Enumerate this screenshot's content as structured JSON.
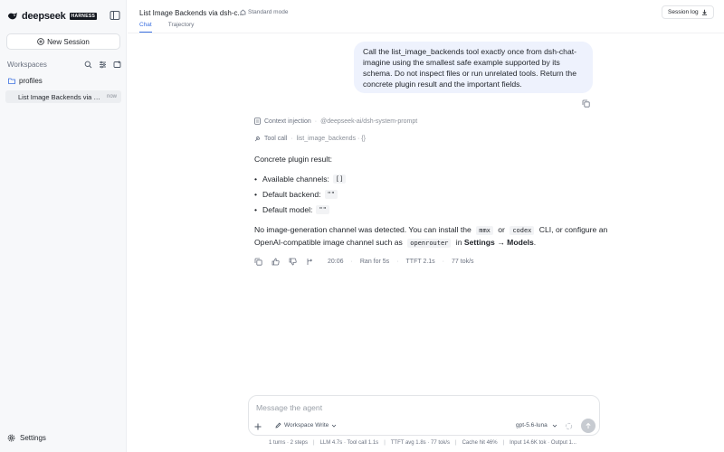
{
  "sidebar": {
    "brand": {
      "name": "deepseek",
      "badge": "HARNESS"
    },
    "new_session_label": "New Session",
    "workspaces_title": "Workspaces",
    "folder": "profiles",
    "session": {
      "name": "List Image Backends via dsh-chat",
      "time": "now"
    },
    "settings_label": "Settings"
  },
  "header": {
    "title": "List Image Backends via dsh-c...",
    "mode": "Standard mode",
    "session_log": "Session log",
    "tabs": [
      {
        "label": "Chat"
      },
      {
        "label": "Trajectory"
      }
    ]
  },
  "conversation": {
    "user_message": "Call the list_image_backends tool exactly once from dsh-chat-imagine using the smallest safe example supported by its schema. Do not inspect files or run unrelated tools. Return the concrete plugin result and the important fields.",
    "context": {
      "label": "Context injection",
      "sep": "·",
      "source": "@deepseek-ai/dsh-system-prompt"
    },
    "tool": {
      "label": "Tool call",
      "sep": "·",
      "name": "list_image_backends · {}"
    },
    "heading": "Concrete plugin result:",
    "bullets": [
      {
        "label": "Available channels:",
        "code": "[]"
      },
      {
        "label": "Default backend:",
        "code": "\"\""
      },
      {
        "label": "Default model:",
        "code": "\"\""
      }
    ],
    "paragraph": {
      "p1": "No image-generation channel was detected. You can install the",
      "c1": "mmx",
      "p2": "or",
      "c2": "codex",
      "p3": "CLI, or configure an",
      "p4": "OpenAI-compatible image channel such as",
      "c3": "openrouter",
      "p5": "in",
      "b1": "Settings",
      "arrow": "→",
      "b2": "Models",
      "end": "."
    },
    "stats": {
      "time": "20:06",
      "ran": "Ran for 5s",
      "ttft": "TTFT 2.1s",
      "speed": "77 tok/s",
      "dot": "·"
    }
  },
  "composer": {
    "placeholder": "Message the agent",
    "workspace": "Workspace Write",
    "model": "gpt-5.6-luna"
  },
  "footer": {
    "turns": "1 turns · 2 steps",
    "llm": "LLM 4.7s · Tool call 1.1s",
    "ttft": "TTFT avg 1.8s · 77 tok/s",
    "cache": "Cache hit 46%",
    "tokens": "Input 14.6K tok · Output 1...",
    "sep": "|"
  },
  "colors": {
    "accent": "#3b6fe0",
    "bubble": "#eef2fd",
    "sidebar": "#f7f8fa"
  }
}
